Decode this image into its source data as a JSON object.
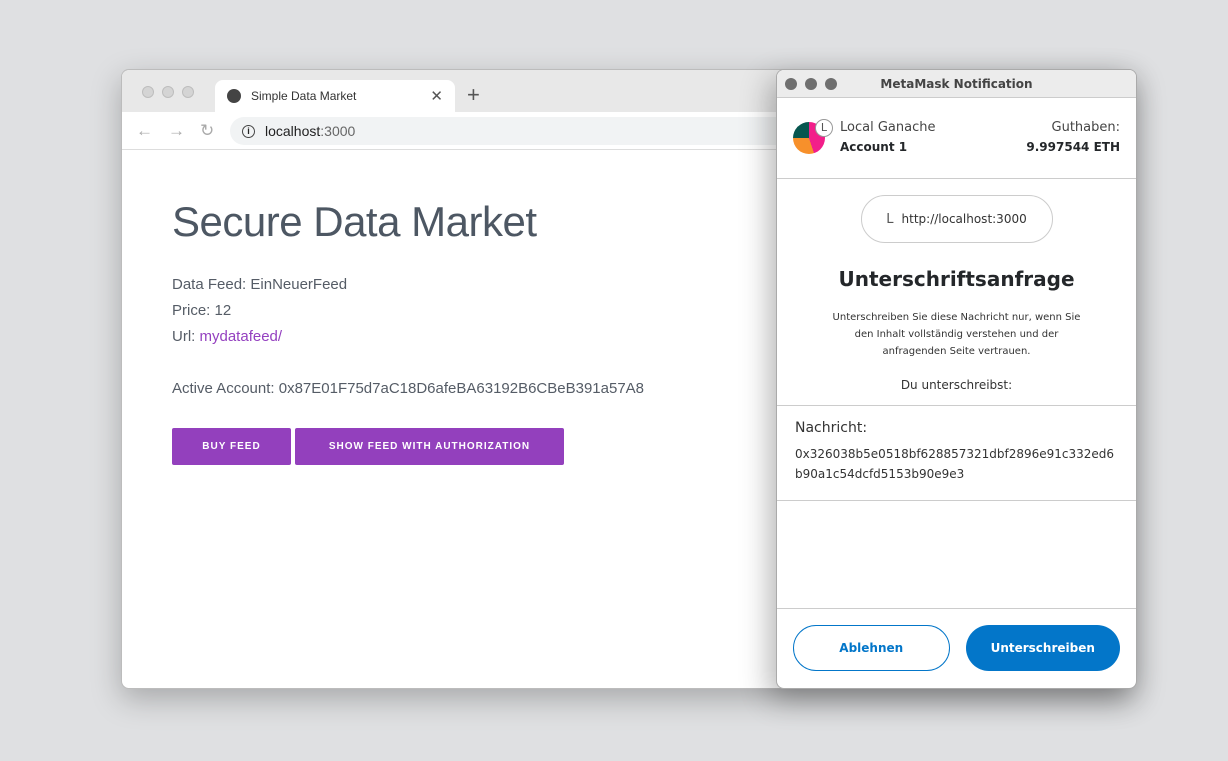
{
  "browser": {
    "tab_title": "Simple Data Market",
    "url_host": "localhost",
    "url_port": ":3000"
  },
  "page": {
    "title": "Secure Data Market",
    "feed_label": "Data Feed: ",
    "feed_value": "EinNeuerFeed",
    "price_label": "Price: ",
    "price_value": "12",
    "url_label": "Url: ",
    "url_value": "mydatafeed/",
    "account_label": "Active Account: ",
    "account_value": "0x87E01F75d7aC18D6afeBA63192B6CBeB391a57A8",
    "buy_label": "BUY FEED",
    "show_label": "SHOW FEED WITH AUTHORIZATION"
  },
  "metamask": {
    "window_title": "MetaMask Notification",
    "network": "Local Ganache",
    "account": "Account 1",
    "network_badge": "L",
    "balance_label": "Guthaben:",
    "balance": "9.997544 ETH",
    "origin_icon": "L",
    "origin": "http://localhost:3000",
    "heading": "Unterschriftsanfrage",
    "description": "Unterschreiben Sie diese Nachricht nur, wenn Sie den Inhalt vollständig verstehen und der anfragenden Seite vertrauen.",
    "signing_label": "Du unterschreibst:",
    "message_label": "Nachricht:",
    "message": "0x326038b5e0518bf628857321dbf2896e91c332ed6b90a1c54dcfd5153b90e9e3",
    "reject_label": "Ablehnen",
    "sign_label": "Unterschreiben"
  }
}
